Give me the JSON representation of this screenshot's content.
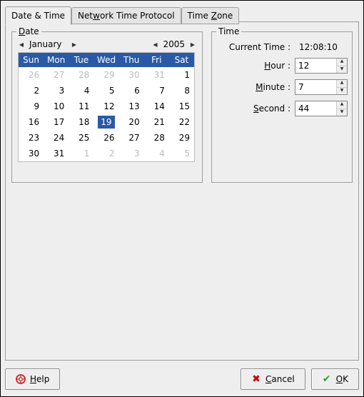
{
  "tabs": {
    "date_time": "Date & Time",
    "ntp_prefix": "Net",
    "ntp_underline": "w",
    "ntp_suffix": "ork Time Protocol",
    "zone_prefix": "Time ",
    "zone_underline": "Z",
    "zone_suffix": "one"
  },
  "date": {
    "legend_ul": "D",
    "legend_suffix": "ate",
    "month": "January",
    "year": "2005",
    "dow": [
      "Sun",
      "Mon",
      "Tue",
      "Wed",
      "Thu",
      "Fri",
      "Sat"
    ],
    "grid": [
      [
        {
          "d": "26",
          "o": true
        },
        {
          "d": "27",
          "o": true
        },
        {
          "d": "28",
          "o": true
        },
        {
          "d": "29",
          "o": true
        },
        {
          "d": "30",
          "o": true
        },
        {
          "d": "31",
          "o": true
        },
        {
          "d": "1"
        }
      ],
      [
        {
          "d": "2"
        },
        {
          "d": "3"
        },
        {
          "d": "4"
        },
        {
          "d": "5"
        },
        {
          "d": "6"
        },
        {
          "d": "7"
        },
        {
          "d": "8"
        }
      ],
      [
        {
          "d": "9"
        },
        {
          "d": "10"
        },
        {
          "d": "11"
        },
        {
          "d": "12"
        },
        {
          "d": "13"
        },
        {
          "d": "14"
        },
        {
          "d": "15"
        }
      ],
      [
        {
          "d": "16"
        },
        {
          "d": "17"
        },
        {
          "d": "18"
        },
        {
          "d": "19",
          "sel": true
        },
        {
          "d": "20"
        },
        {
          "d": "21"
        },
        {
          "d": "22"
        }
      ],
      [
        {
          "d": "23"
        },
        {
          "d": "24"
        },
        {
          "d": "25"
        },
        {
          "d": "26"
        },
        {
          "d": "27"
        },
        {
          "d": "28"
        },
        {
          "d": "29"
        }
      ],
      [
        {
          "d": "30"
        },
        {
          "d": "31"
        },
        {
          "d": "1",
          "o": true
        },
        {
          "d": "2",
          "o": true
        },
        {
          "d": "3",
          "o": true
        },
        {
          "d": "4",
          "o": true
        },
        {
          "d": "5",
          "o": true
        }
      ]
    ]
  },
  "time": {
    "legend": "Time",
    "current_label": "Current Time :",
    "current_value": "12:08:10",
    "hour_label_ul": "H",
    "hour_label_suffix": "our :",
    "hour_value": "12",
    "minute_label_ul": "M",
    "minute_label_suffix": "inute :",
    "minute_value": "7",
    "second_label_ul": "S",
    "second_label_suffix": "econd :",
    "second_value": "44"
  },
  "buttons": {
    "help_ul": "H",
    "help_suffix": "elp",
    "cancel_ul": "C",
    "cancel_suffix": "ancel",
    "ok_ul": "O",
    "ok_suffix": "K"
  }
}
